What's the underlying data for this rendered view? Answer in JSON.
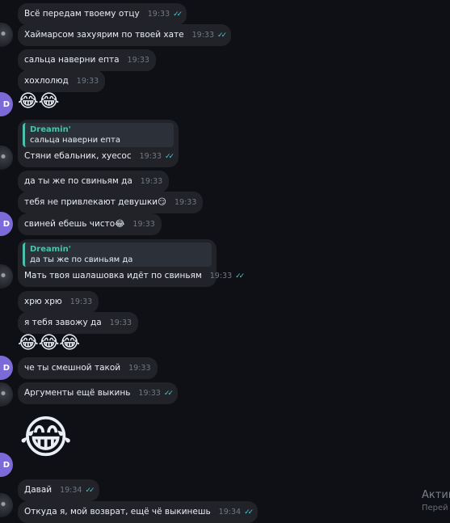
{
  "messages": [
    {
      "text": "Всё передам твоему отцу",
      "time": "19:33",
      "read": "✓✓"
    },
    {
      "text": "Хаймарсом захуярим по твоей хате",
      "time": "19:33",
      "read": "✓✓"
    },
    {
      "text": "сальца наверни епта",
      "time": "19:33"
    },
    {
      "text": "хохлолюд",
      "time": "19:33"
    },
    {
      "emoji": "😂😂"
    },
    {
      "quote_name": "Dreamin'",
      "quote_text": "сальца наверни епта",
      "text": "Стяни ебальник, хуесос",
      "time": "19:33",
      "read": "✓✓"
    },
    {
      "text": "да ты же по свиньям да",
      "time": "19:33"
    },
    {
      "text": "тебя не привлекают девушки😏",
      "time": "19:33"
    },
    {
      "text": "свиней ебешь чисто😂",
      "time": "19:33"
    },
    {
      "quote_name": "Dreamin'",
      "quote_text": "да ты же по свиньям да",
      "text": "Мать твоя шалашовка идёт по свиньям",
      "time": "19:33",
      "read": "✓✓"
    },
    {
      "text": "хрю хрю",
      "time": "19:33"
    },
    {
      "text": "я тебя завожу да",
      "time": "19:33"
    },
    {
      "emoji": "😂😂😂"
    },
    {
      "text": "че ты смешной такой",
      "time": "19:33"
    },
    {
      "text": "Аргументы ещё выкинь",
      "time": "19:33",
      "read": "✓✓"
    },
    {
      "emoji": "😂"
    },
    {
      "text": "Давай",
      "time": "19:34",
      "read": "✓✓"
    },
    {
      "text": "Откуда я, мой возврат, ещё чё выкинешь",
      "time": "19:34",
      "read": "✓✓"
    }
  ],
  "avatar_letter": "D",
  "watermark": {
    "line1": "Актив",
    "line2": "Перей"
  },
  "colors": {
    "accent": "#4cc1a9",
    "bubble": "#212329",
    "background": "#0e1015"
  }
}
